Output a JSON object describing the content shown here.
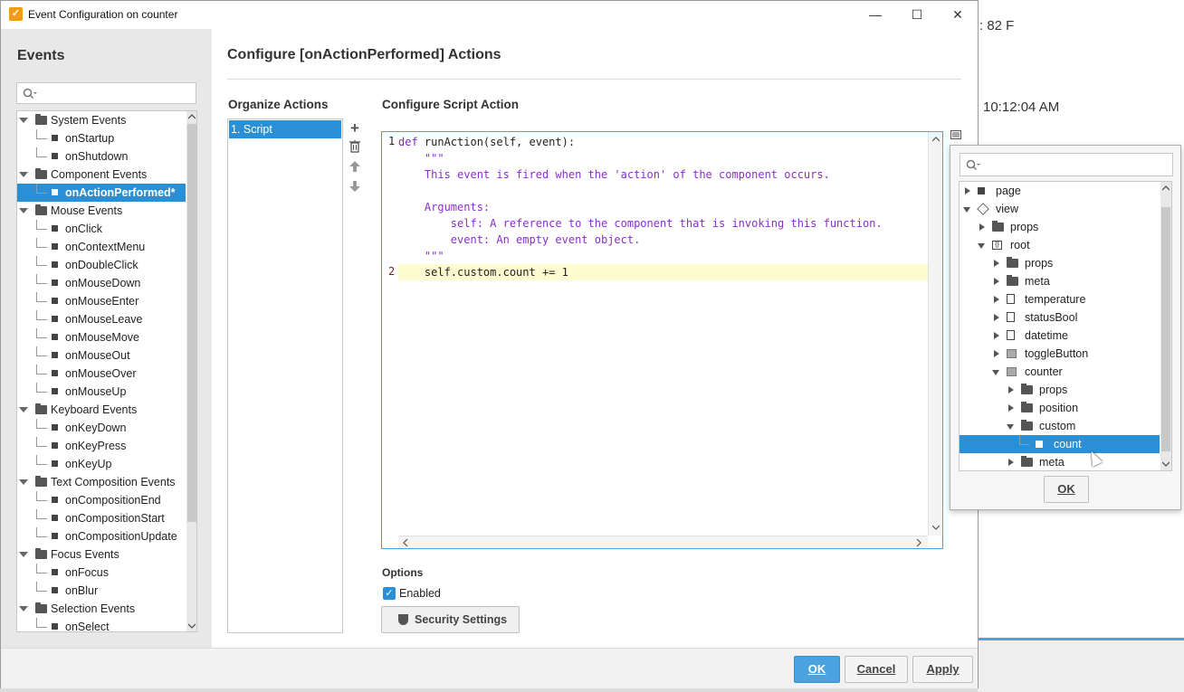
{
  "window": {
    "title": "Event Configuration on counter",
    "minimize": "—",
    "maximize": "☐",
    "close": "✕"
  },
  "background": {
    "temperature_text": ": 82 F",
    "time_text": "10:12:04 AM"
  },
  "events_panel": {
    "heading": "Events",
    "search_placeholder": "",
    "tree": [
      {
        "label": "System Events",
        "level": 0
      },
      {
        "label": "onStartup",
        "level": 1
      },
      {
        "label": "onShutdown",
        "level": 1
      },
      {
        "label": "Component Events",
        "level": 0
      },
      {
        "label": "onActionPerformed*",
        "level": 1,
        "selected": true
      },
      {
        "label": "Mouse Events",
        "level": 0
      },
      {
        "label": "onClick",
        "level": 1
      },
      {
        "label": "onContextMenu",
        "level": 1
      },
      {
        "label": "onDoubleClick",
        "level": 1
      },
      {
        "label": "onMouseDown",
        "level": 1
      },
      {
        "label": "onMouseEnter",
        "level": 1
      },
      {
        "label": "onMouseLeave",
        "level": 1
      },
      {
        "label": "onMouseMove",
        "level": 1
      },
      {
        "label": "onMouseOut",
        "level": 1
      },
      {
        "label": "onMouseOver",
        "level": 1
      },
      {
        "label": "onMouseUp",
        "level": 1
      },
      {
        "label": "Keyboard Events",
        "level": 0
      },
      {
        "label": "onKeyDown",
        "level": 1
      },
      {
        "label": "onKeyPress",
        "level": 1
      },
      {
        "label": "onKeyUp",
        "level": 1
      },
      {
        "label": "Text Composition Events",
        "level": 0
      },
      {
        "label": "onCompositionEnd",
        "level": 1
      },
      {
        "label": "onCompositionStart",
        "level": 1
      },
      {
        "label": "onCompositionUpdate",
        "level": 1
      },
      {
        "label": "Focus Events",
        "level": 0
      },
      {
        "label": "onFocus",
        "level": 1
      },
      {
        "label": "onBlur",
        "level": 1
      },
      {
        "label": "Selection Events",
        "level": 0
      },
      {
        "label": "onSelect",
        "level": 1
      }
    ]
  },
  "main": {
    "heading": "Configure [onActionPerformed] Actions",
    "organize_heading": "Organize Actions",
    "actions": [
      "1. Script"
    ],
    "script_heading": "Configure Script Action",
    "code": {
      "line1_num": "1",
      "line2_num": "2",
      "def_kw": "def",
      "def_rest": " runAction(self, event):",
      "doc_lines": [
        "    \"\"\"",
        "    This event is fired when the 'action' of the component occurs.",
        "",
        "    Arguments:",
        "        self: A reference to the component that is invoking this function.",
        "        event: An empty event object.",
        "    \"\"\""
      ],
      "line2": "    self.custom.count += 1"
    },
    "options_heading": "Options",
    "enabled_label": "Enabled",
    "security_button": "Security Settings"
  },
  "footer": {
    "ok": "OK",
    "cancel": "Cancel",
    "apply": "Apply"
  },
  "property_popup": {
    "search_placeholder": "",
    "ok": "OK",
    "tree": [
      {
        "label": "page",
        "depth": 0,
        "icon": "square",
        "arrow": "closed"
      },
      {
        "label": "view",
        "depth": 0,
        "icon": "cube",
        "arrow": "open"
      },
      {
        "label": "props",
        "depth": 1,
        "icon": "folder",
        "arrow": "closed"
      },
      {
        "label": "root",
        "depth": 1,
        "icon": "object",
        "arrow": "open"
      },
      {
        "label": "props",
        "depth": 2,
        "icon": "folder",
        "arrow": "closed"
      },
      {
        "label": "meta",
        "depth": 2,
        "icon": "folder",
        "arrow": "closed"
      },
      {
        "label": "temperature",
        "depth": 2,
        "icon": "doc",
        "arrow": "closed"
      },
      {
        "label": "statusBool",
        "depth": 2,
        "icon": "doc",
        "arrow": "closed"
      },
      {
        "label": "datetime",
        "depth": 2,
        "icon": "doc",
        "arrow": "closed"
      },
      {
        "label": "toggleButton",
        "depth": 2,
        "icon": "component",
        "arrow": "closed"
      },
      {
        "label": "counter",
        "depth": 2,
        "icon": "component",
        "arrow": "open"
      },
      {
        "label": "props",
        "depth": 3,
        "icon": "folder",
        "arrow": "closed"
      },
      {
        "label": "position",
        "depth": 3,
        "icon": "folder",
        "arrow": "closed"
      },
      {
        "label": "custom",
        "depth": 3,
        "icon": "folder",
        "arrow": "open"
      },
      {
        "label": "count",
        "depth": 4,
        "icon": "square",
        "arrow": "none",
        "selected": true
      },
      {
        "label": "meta",
        "depth": 3,
        "icon": "folder",
        "arrow": "closed"
      }
    ]
  }
}
